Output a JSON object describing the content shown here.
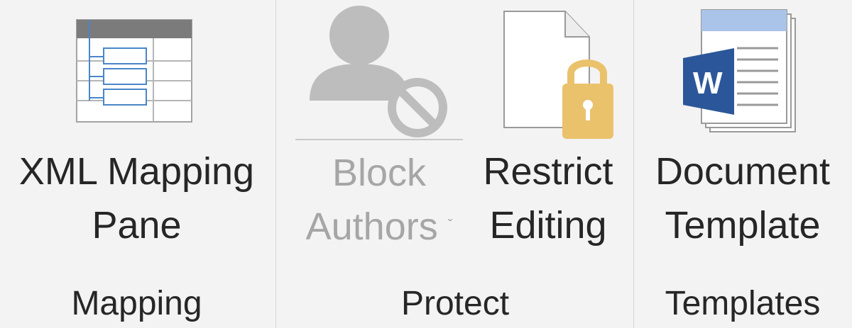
{
  "groups": [
    {
      "label": "Mapping",
      "buttons": [
        {
          "line1": "XML Mapping",
          "line2": "Pane",
          "icon": "xml-mapping-pane-icon",
          "enabled": true
        }
      ]
    },
    {
      "label": "Protect",
      "buttons": [
        {
          "line1": "Block",
          "line2": "Authors",
          "icon": "block-authors-icon",
          "enabled": false,
          "dropdown": "ˇ"
        },
        {
          "line1": "Restrict",
          "line2": "Editing",
          "icon": "restrict-editing-icon",
          "enabled": true
        }
      ]
    },
    {
      "label": "Templates",
      "buttons": [
        {
          "line1": "Document",
          "line2": "Template",
          "icon": "document-template-icon",
          "enabled": true,
          "icon_letter": "W"
        }
      ]
    }
  ],
  "colors": {
    "ribbon_bg": "#f3f3f3",
    "text": "#262626",
    "disabled_text": "#a6a6a6",
    "word_blue": "#2b579a",
    "lock_gold": "#eac26c",
    "xml_blue": "#4a86c8"
  }
}
